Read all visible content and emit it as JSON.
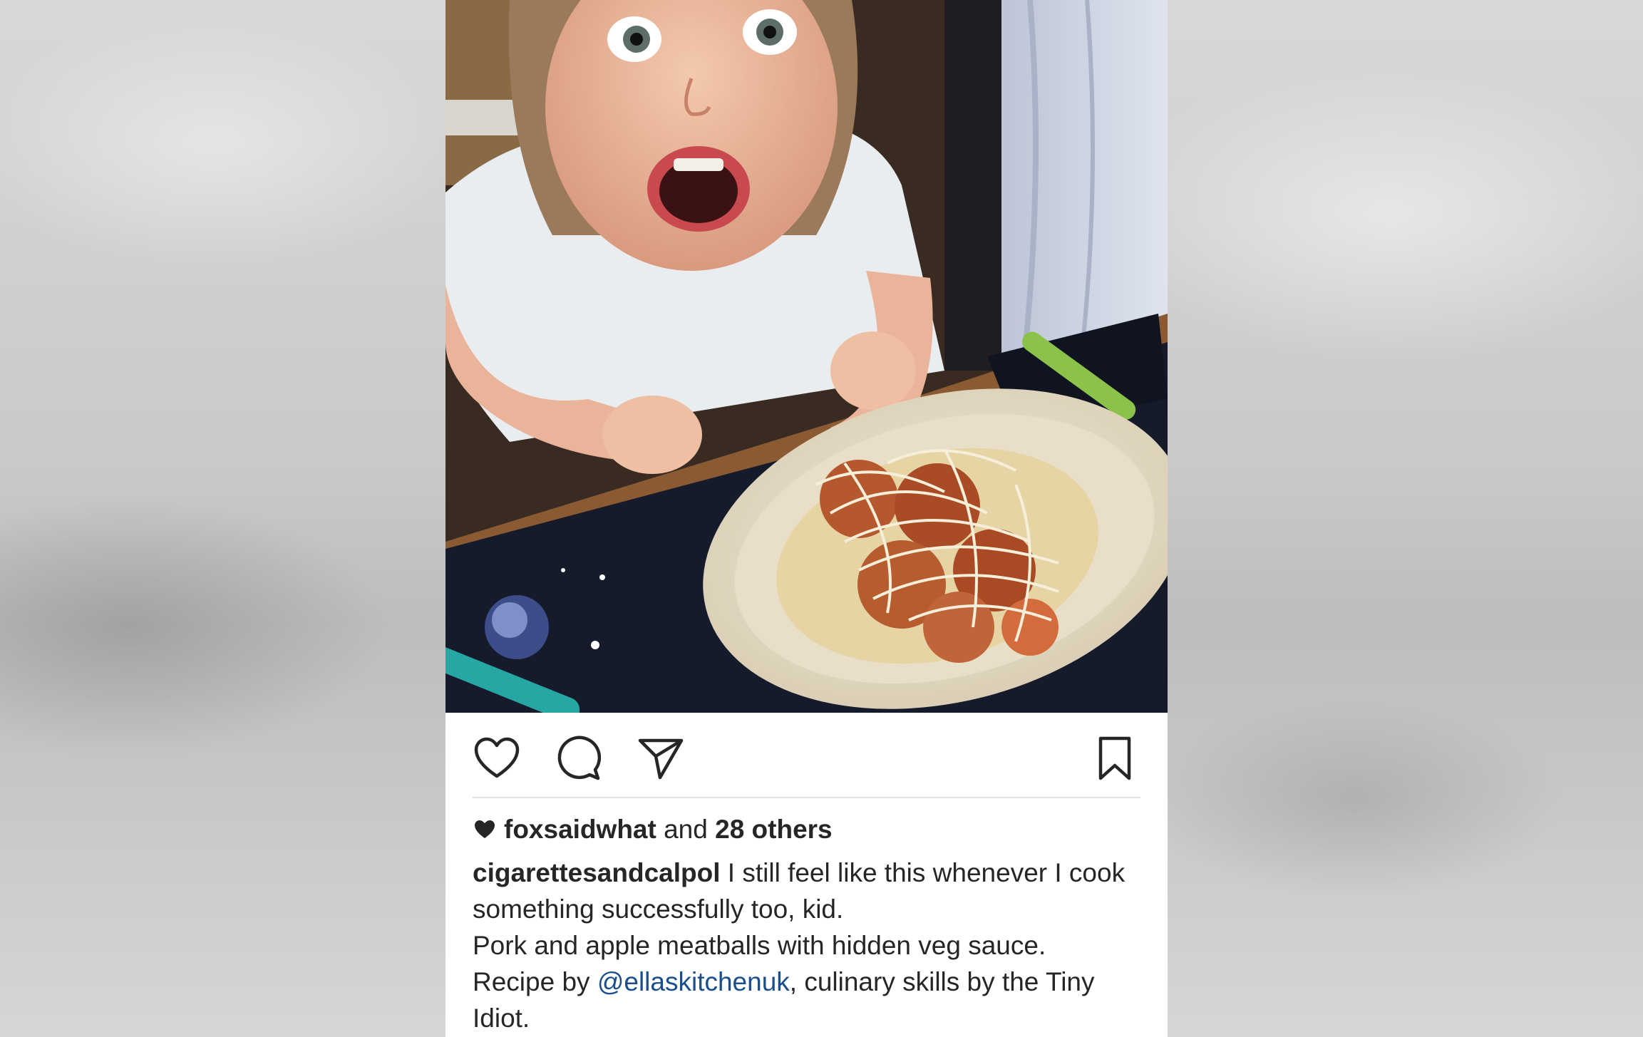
{
  "post": {
    "photo_alt": "",
    "actions": {
      "like_icon": "heart-outline-icon",
      "comment_icon": "comment-bubble-icon",
      "share_icon": "paper-plane-icon",
      "save_icon": "bookmark-icon"
    },
    "likes": {
      "first_liker": "foxsaidwhat",
      "and_text": " and ",
      "others_count": "28 others"
    },
    "caption": {
      "author": "cigarettesandcalpol",
      "line1": " I still feel like this whenever I cook something successfully too, kid.",
      "line2": "Pork and apple meatballs with hidden veg sauce.",
      "line3_prefix": "Recipe by ",
      "mention": "@ellaskitchenuk",
      "line3_suffix": ", culinary skills by the Tiny Idiot."
    }
  },
  "colors": {
    "text": "#262626",
    "mention": "#1b4e8c",
    "divider": "#e4e4e4",
    "backdrop": "#cfcfcf"
  }
}
